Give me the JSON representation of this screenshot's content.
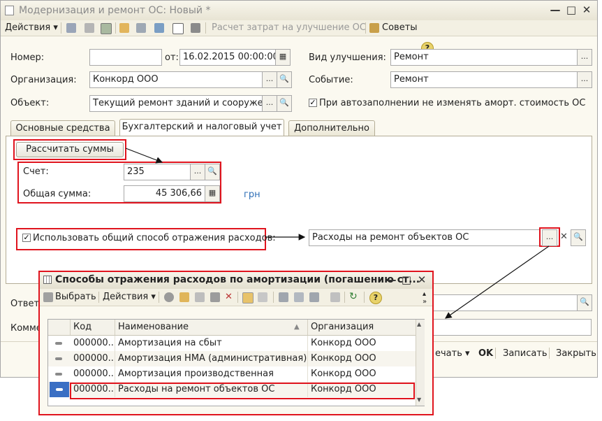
{
  "window": {
    "title": "Модернизация и ремонт ОС: Новый *"
  },
  "toolbar": {
    "actions": "Действия",
    "calc_costs": "Расчет затрат на улучшение ОС",
    "tips": "Советы"
  },
  "form": {
    "number_label": "Номер:",
    "number_value": "",
    "from_label": "от:",
    "date_value": "16.02.2015 00:00:00",
    "org_label": "Организация:",
    "org_value": "Конкорд ООО",
    "object_label": "Объект:",
    "object_value": "Текущий ремонт зданий и сооружени",
    "improvement_label": "Вид улучшения:",
    "improvement_value": "Ремонт",
    "event_label": "Событие:",
    "event_value": "Ремонт",
    "autofill_label": "При автозаполнении не изменять аморт. стоимость ОС"
  },
  "tabs": [
    "Основные средства",
    "Бухгалтерский и налоговый учет",
    "Дополнительно"
  ],
  "accounting": {
    "calc_button": "Рассчитать суммы",
    "account_label": "Счет:",
    "account_value": "235",
    "total_label": "Общая сумма:",
    "total_value": "45 306,66",
    "currency": "грн",
    "use_common_label": "Использовать общий способ отражения расходов:",
    "expense_method_value": "Расходы на ремонт объектов ОС"
  },
  "bottom": {
    "responsible_label": "Ответ",
    "comment_label": "Комме",
    "print": "ечать",
    "ok": "OK",
    "save": "Записать",
    "close": "Закрыть"
  },
  "dialog": {
    "title": "Способы отражения расходов по амортизации (погашению ст...",
    "select": "Выбрать",
    "actions": "Действия",
    "columns": [
      "Код",
      "Наименование",
      "Организация"
    ],
    "rows": [
      {
        "code": "000000...",
        "name": "Амортизация на сбыт",
        "org": "Конкорд ООО"
      },
      {
        "code": "000000...",
        "name": "Амортизация НМА (административная)",
        "org": "Конкорд ООО"
      },
      {
        "code": "000000...",
        "name": "Амортизация производственная",
        "org": "Конкорд ООО"
      },
      {
        "code": "000000...",
        "name": "Расходы на ремонт объектов ОС",
        "org": "Конкорд ООО"
      }
    ]
  }
}
